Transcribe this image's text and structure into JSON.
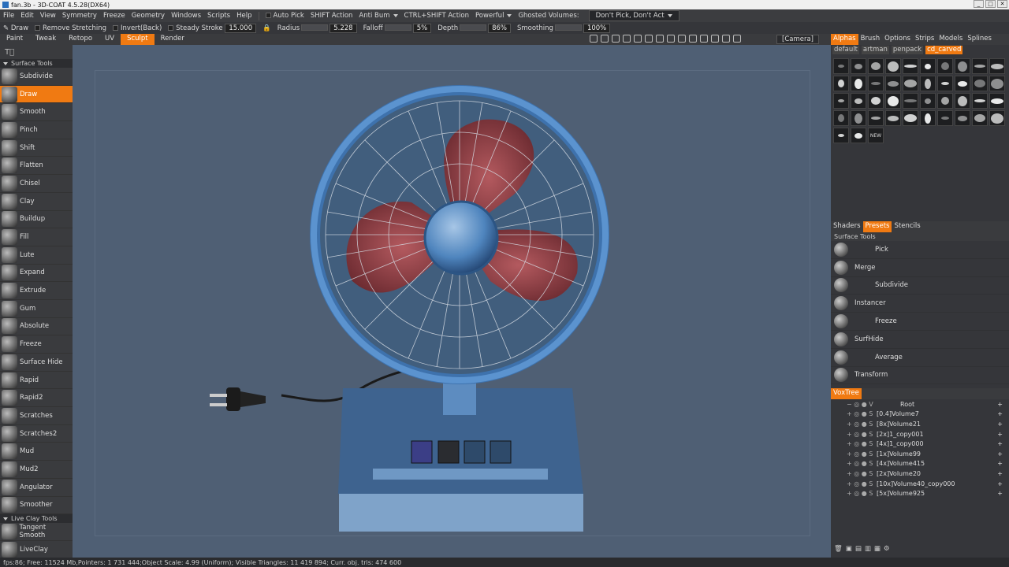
{
  "window": {
    "title": "fan.3b - 3D-COAT 4.5.28(DX64)"
  },
  "menu": {
    "items": [
      "File",
      "Edit",
      "View",
      "Symmetry",
      "Freeze",
      "Geometry",
      "Windows",
      "Scripts",
      "Help"
    ],
    "auto_pick": "Auto Pick",
    "shift_action": "SHIFT Action",
    "anti_bump": "Anti Bum",
    "ctrl_shift_action": "CTRL+SHIFT Action",
    "powerful": "Powerful",
    "ghosted_volumes": "Ghosted Volumes:",
    "ghost_mode": "Don't Pick, Don't Act"
  },
  "toolbar": {
    "tool": "Draw",
    "remove_stretching": "Remove Stretching",
    "invert_back": "Invert(Back)",
    "steady_stroke": "Steady Stroke",
    "steady_value": "15.000",
    "radius_label": "Radius",
    "radius_value": "5.228",
    "falloff_label": "Falloff",
    "falloff_value": "5%",
    "depth_label": "Depth",
    "depth_value": "86%",
    "smoothing_label": "Smoothing",
    "smoothing_value": "100%"
  },
  "rooms": [
    "Paint",
    "Tweak",
    "Retopo",
    "UV",
    "Sculpt",
    "Render"
  ],
  "active_room": "Sculpt",
  "camera": "[Camera]",
  "left_panel": {
    "surface_tools": "Surface Tools",
    "tools": [
      "Subdivide",
      "Draw",
      "Smooth",
      "Pinch",
      "Shift",
      "Flatten",
      "Chisel",
      "Clay",
      "Buildup",
      "Fill",
      "Lute",
      "Expand",
      "Extrude",
      "Gum",
      "Absolute",
      "Freeze",
      "Surface Hide",
      "Rapid",
      "Rapid2",
      "Scratches",
      "Scratches2",
      "Mud",
      "Mud2",
      "Angulator",
      "Smoother"
    ],
    "active_tool": "Draw",
    "live_clay": "Live Clay Tools",
    "live_tools": [
      "Tangent Smooth",
      "LiveClay"
    ]
  },
  "right_panel": {
    "top_tabs": [
      "Alphas",
      "Brush",
      "Options",
      "Strips",
      "Models",
      "Splines"
    ],
    "active_top": "Alphas",
    "alpha_packs": [
      "default",
      "artman",
      "penpack",
      "cd_carved"
    ],
    "active_pack": "cd_carved",
    "new_label": "NEW",
    "mid_tabs": [
      "Shaders",
      "Presets",
      "Stencils"
    ],
    "active_mid": "Presets",
    "presets_header": "Surface Tools",
    "presets": [
      "Pick",
      "Merge",
      "Subdivide",
      "Instancer",
      "Freeze",
      "SurfHide",
      "Average",
      "Transform"
    ],
    "voxtree_tab": "VoxTree",
    "root": "Root",
    "volumes": [
      "[0.4]Volume7",
      "[8x]Volume21",
      "[2x]1_copy001",
      "[4x]1_copy000",
      "[1x]Volume99",
      "[4x]Volume415",
      "[2x]Volume20",
      "[10x]Volume40_copy000",
      "[5x]Volume925"
    ]
  },
  "status": "fps:86;     Free: 11524 Mb,Pointers: 1 731 444;Object Scale: 4.99 (Uniform); Visible Triangles: 11 419 894; Curr. obj. tris: 474 600",
  "colors": {
    "accent": "#f07a12",
    "viewport": "#4f5f74",
    "fan_blue": "#3f77b5",
    "blade_red": "#8c3a3e"
  }
}
